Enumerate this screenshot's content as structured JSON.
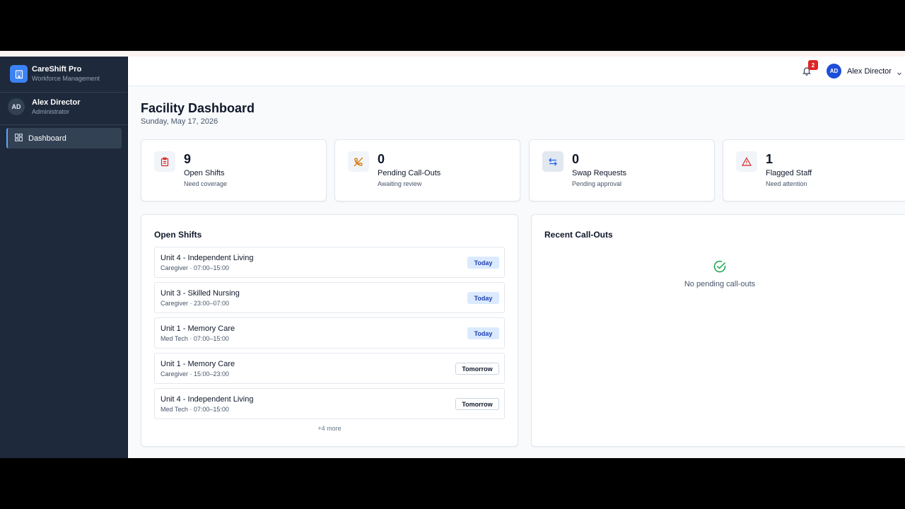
{
  "app": {
    "name": "CareShift Pro",
    "subtitle": "Workforce Management"
  },
  "sidebar": {
    "user": {
      "initials": "AD",
      "name": "Alex Director",
      "role": "Administrator"
    },
    "items": [
      {
        "label": "Dashboard",
        "icon": "grid-icon",
        "active": true
      }
    ]
  },
  "header": {
    "notifications": "2",
    "user": {
      "initials": "AD",
      "name": "Alex Director"
    }
  },
  "page": {
    "title": "Facility Dashboard",
    "date": "Sunday, May 17, 2026"
  },
  "stats": [
    {
      "value": "9",
      "label": "Open Shifts",
      "sub": "Need coverage",
      "icon": "clipboard-icon",
      "color": "#dc2626"
    },
    {
      "value": "0",
      "label": "Pending Call-Outs",
      "sub": "Awaiting review",
      "icon": "phone-off-icon",
      "color": "#d97706"
    },
    {
      "value": "0",
      "label": "Swap Requests",
      "sub": "Pending approval",
      "icon": "swap-icon",
      "color": "#2563eb"
    },
    {
      "value": "1",
      "label": "Flagged Staff",
      "sub": "Need attention",
      "icon": "warning-icon",
      "color": "#dc2626"
    }
  ],
  "open_shifts": {
    "title": "Open Shifts",
    "items": [
      {
        "name": "Unit 4 - Independent Living",
        "detail": "Caregiver · 07:00–15:00",
        "tag": "Today"
      },
      {
        "name": "Unit 3 - Skilled Nursing",
        "detail": "Caregiver · 23:00–07:00",
        "tag": "Today"
      },
      {
        "name": "Unit 1 - Memory Care",
        "detail": "Med Tech · 07:00–15:00",
        "tag": "Today"
      },
      {
        "name": "Unit 1 - Memory Care",
        "detail": "Caregiver · 15:00–23:00",
        "tag": "Tomorrow"
      },
      {
        "name": "Unit 4 - Independent Living",
        "detail": "Med Tech · 07:00–15:00",
        "tag": "Tomorrow"
      }
    ],
    "more": "+4 more"
  },
  "callouts": {
    "title": "Recent Call-Outs",
    "empty": "No pending call-outs"
  }
}
